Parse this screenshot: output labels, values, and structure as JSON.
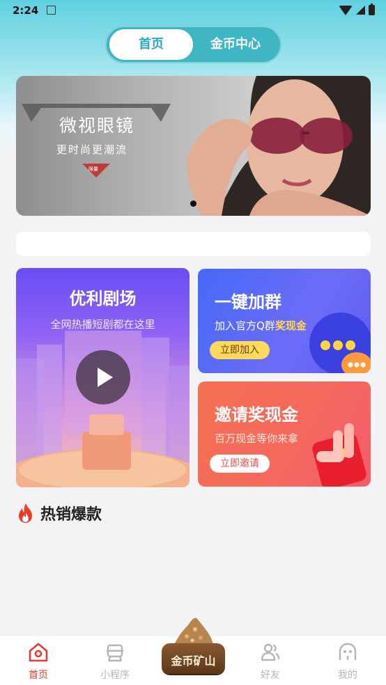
{
  "status_bar": {
    "time": "2:24"
  },
  "top_tabs": {
    "home": "首页",
    "coin_center": "金币中心"
  },
  "banner": {
    "title": "微视眼镜",
    "subtitle": "更时尚更潮流",
    "tag": "限量"
  },
  "cards": {
    "drama": {
      "title": "优利剧场",
      "subtitle": "全网热播短剧都在这里"
    },
    "group": {
      "title": "一键加群",
      "subtitle_prefix": "加入官方Q群",
      "subtitle_highlight": "奖现金",
      "button": "立即加入"
    },
    "invite": {
      "title": "邀请奖现金",
      "subtitle": "百万现金等你来拿",
      "button": "立即邀请"
    }
  },
  "hot_section": {
    "title": "热销爆款"
  },
  "tabbar": {
    "home": "首页",
    "mini_program": "小程序",
    "coin_mine": "金币矿山",
    "friends": "好友",
    "me": "我的",
    "active_color": "#e63a2e",
    "inactive_color": "#b5b5b5"
  },
  "colors": {
    "accent": "#3fb6c4",
    "highlight": "#ffd84d"
  }
}
